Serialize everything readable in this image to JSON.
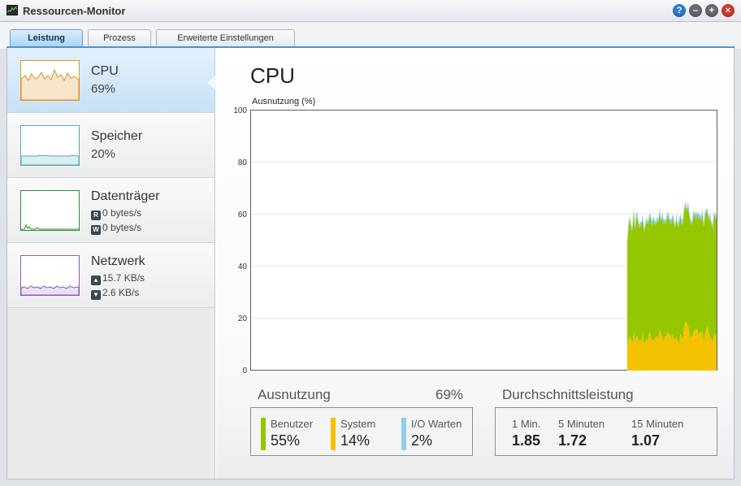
{
  "window": {
    "title": "Ressourcen-Monitor"
  },
  "tabs": [
    {
      "label": "Leistung",
      "active": true
    },
    {
      "label": "Prozess",
      "active": false
    },
    {
      "label": "Erweiterte Einstellungen",
      "active": false
    }
  ],
  "sidebar": {
    "cpu": {
      "title": "CPU",
      "value": "69%",
      "color": "#d8932a"
    },
    "memory": {
      "title": "Speicher",
      "value": "20%",
      "color": "#5aa7b0"
    },
    "disk": {
      "title": "Datenträger",
      "read_icon": "R",
      "read": "0 bytes/s",
      "write_icon": "W",
      "write": "0 bytes/s",
      "color": "#2f8a35"
    },
    "network": {
      "title": "Netzwerk",
      "upload": "15.7 KB/s",
      "download": "2.6 KB/s",
      "color": "#8a5ab4"
    }
  },
  "main": {
    "title": "CPU",
    "y_axis_label": "Ausnutzung (%)",
    "utilization": {
      "heading": "Ausnutzung",
      "total": "69%"
    },
    "breakdown": [
      {
        "label": "Benutzer",
        "value": "55%",
        "color": "#94c700"
      },
      {
        "label": "System",
        "value": "14%",
        "color": "#f4c200"
      },
      {
        "label": "I/O Warten",
        "value": "2%",
        "color": "#93cdea"
      }
    ],
    "load_average": {
      "heading": "Durchschnittsleistung",
      "items": [
        {
          "label": "1 Min.",
          "value": "1.85"
        },
        {
          "label": "5 Minuten",
          "value": "1.72"
        },
        {
          "label": "15 Minuten",
          "value": "1.07"
        }
      ]
    }
  },
  "chart_data": {
    "type": "area",
    "title": "",
    "xlabel": "",
    "ylabel": "Ausnutzung (%)",
    "ylim": [
      0,
      100
    ],
    "yticks": [
      "0",
      "20",
      "40",
      "60",
      "80",
      "100"
    ],
    "grid": true,
    "series": [
      {
        "name": "System",
        "color": "#f4c200",
        "values": [
          9,
          12,
          13,
          12,
          10,
          15,
          11,
          13,
          13,
          11,
          12,
          11,
          14,
          10,
          11,
          12,
          12,
          15,
          14,
          11,
          12,
          11,
          13,
          13,
          12,
          16,
          14,
          13,
          11,
          13,
          13,
          15,
          14,
          14,
          12,
          14,
          12,
          12,
          13,
          11,
          10,
          14,
          13,
          12,
          17,
          19,
          18,
          17,
          14,
          12,
          13,
          14,
          16,
          15,
          16,
          13,
          15,
          14,
          15,
          11,
          13,
          16,
          17,
          14,
          13,
          12,
          11,
          14,
          13,
          14
        ]
      },
      {
        "name": "Benutzer",
        "color": "#94c700",
        "values": [
          40,
          43,
          45,
          42,
          44,
          46,
          43,
          46,
          45,
          44,
          43,
          45,
          44,
          43,
          44,
          45,
          44,
          43,
          45,
          44,
          46,
          45,
          43,
          44,
          45,
          44,
          43,
          46,
          45,
          44,
          43,
          45,
          44,
          43,
          44,
          45,
          44,
          43,
          45,
          44,
          46,
          45,
          43,
          44,
          45,
          44,
          43,
          46,
          45,
          44,
          43,
          45,
          44,
          43,
          44,
          45,
          44,
          43,
          45,
          44,
          46,
          45,
          43,
          44,
          45,
          44,
          43,
          46,
          45,
          44
        ]
      },
      {
        "name": "I/O Warten",
        "color": "#93cdea",
        "values": [
          1,
          2,
          1,
          2,
          1,
          2,
          1,
          2,
          2,
          1,
          2,
          1,
          2,
          1,
          2,
          2,
          1,
          2,
          1,
          2,
          1,
          2,
          1,
          2,
          1,
          2,
          1,
          2,
          2,
          1,
          2,
          1,
          2,
          1,
          2,
          1,
          2,
          1,
          2,
          1,
          2,
          1,
          2,
          2,
          1,
          2,
          1,
          2,
          1,
          2,
          1,
          2,
          1,
          2,
          1,
          2,
          1,
          2,
          2,
          1,
          2,
          1,
          2,
          1,
          2,
          1,
          2,
          1,
          2,
          1
        ]
      }
    ]
  }
}
